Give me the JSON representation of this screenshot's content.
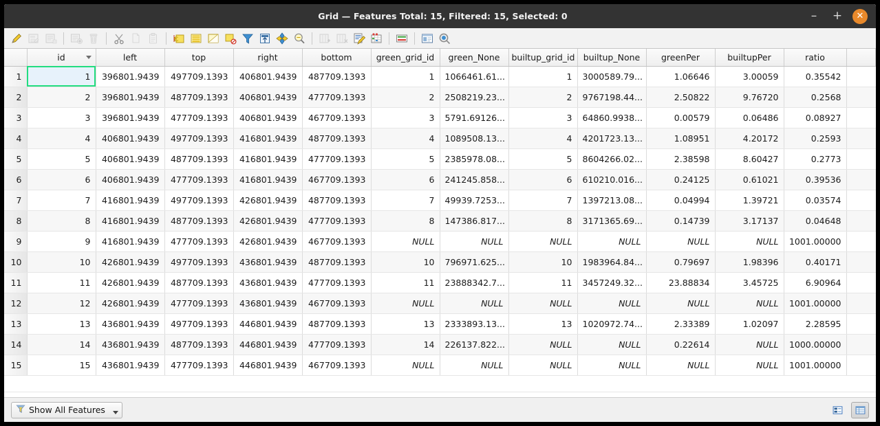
{
  "window": {
    "title": "Grid — Features Total: 15, Filtered: 15, Selected: 0",
    "minimize_label": "–",
    "maximize_label": "+",
    "close_label": "✕"
  },
  "toolbar": {
    "buttons": [
      {
        "name": "toggle-editing-icon",
        "enabled": true
      },
      {
        "name": "save-edits-icon",
        "enabled": false
      },
      {
        "name": "reload-table-icon",
        "enabled": false
      },
      {
        "name": "add-feature-icon",
        "enabled": false
      },
      {
        "name": "delete-selected-icon",
        "enabled": false
      },
      {
        "name": "cut-features-icon",
        "enabled": false
      },
      {
        "name": "copy-features-icon",
        "enabled": false
      },
      {
        "name": "paste-features-icon",
        "enabled": false
      },
      {
        "name": "select-by-expression-icon",
        "enabled": true
      },
      {
        "name": "select-all-icon",
        "enabled": true
      },
      {
        "name": "invert-selection-icon",
        "enabled": true
      },
      {
        "name": "deselect-all-icon",
        "enabled": true
      },
      {
        "name": "filter-selection-icon",
        "enabled": true
      },
      {
        "name": "move-selection-to-top-icon",
        "enabled": true
      },
      {
        "name": "pan-to-selection-icon",
        "enabled": true
      },
      {
        "name": "zoom-to-selection-icon",
        "enabled": true
      },
      {
        "name": "new-field-icon",
        "enabled": false
      },
      {
        "name": "delete-field-icon",
        "enabled": false
      },
      {
        "name": "field-calculator-icon",
        "enabled": true
      },
      {
        "name": "conditional-formatting-icon",
        "enabled": true
      },
      {
        "name": "multi-edit-icon",
        "enabled": true
      },
      {
        "name": "form-view-icon",
        "enabled": true
      },
      {
        "name": "actions-icon",
        "enabled": true
      }
    ]
  },
  "table": {
    "columns": [
      {
        "label": "id",
        "sorted": true
      },
      {
        "label": "left",
        "sorted": false
      },
      {
        "label": "top",
        "sorted": false
      },
      {
        "label": "right",
        "sorted": false
      },
      {
        "label": "bottom",
        "sorted": false
      },
      {
        "label": "green_grid_id",
        "sorted": false
      },
      {
        "label": "green_None",
        "sorted": false
      },
      {
        "label": "builtup_grid_id",
        "sorted": false
      },
      {
        "label": "builtup_None",
        "sorted": false
      },
      {
        "label": "greenPer",
        "sorted": false
      },
      {
        "label": "builtupPer",
        "sorted": false
      },
      {
        "label": "ratio",
        "sorted": false
      }
    ],
    "selected_cell": {
      "row": 0,
      "col": 0
    },
    "rows": [
      {
        "n": "1",
        "cells": [
          "1",
          "396801.9439",
          "497709.1393",
          "406801.9439",
          "487709.1393",
          "1",
          "1066461.61...",
          "1",
          "3000589.79...",
          "1.06646",
          "3.00059",
          "0.35542"
        ]
      },
      {
        "n": "2",
        "cells": [
          "2",
          "396801.9439",
          "487709.1393",
          "406801.9439",
          "477709.1393",
          "2",
          "2508219.23...",
          "2",
          "9767198.44...",
          "2.50822",
          "9.76720",
          "0.2568"
        ]
      },
      {
        "n": "3",
        "cells": [
          "3",
          "396801.9439",
          "477709.1393",
          "406801.9439",
          "467709.1393",
          "3",
          "5791.69126...",
          "3",
          "64860.9938...",
          "0.00579",
          "0.06486",
          "0.08927"
        ]
      },
      {
        "n": "4",
        "cells": [
          "4",
          "406801.9439",
          "497709.1393",
          "416801.9439",
          "487709.1393",
          "4",
          "1089508.13...",
          "4",
          "4201723.13...",
          "1.08951",
          "4.20172",
          "0.2593"
        ]
      },
      {
        "n": "5",
        "cells": [
          "5",
          "406801.9439",
          "487709.1393",
          "416801.9439",
          "477709.1393",
          "5",
          "2385978.08...",
          "5",
          "8604266.02...",
          "2.38598",
          "8.60427",
          "0.2773"
        ]
      },
      {
        "n": "6",
        "cells": [
          "6",
          "406801.9439",
          "477709.1393",
          "416801.9439",
          "467709.1393",
          "6",
          "241245.858...",
          "6",
          "610210.016...",
          "0.24125",
          "0.61021",
          "0.39536"
        ]
      },
      {
        "n": "7",
        "cells": [
          "7",
          "416801.9439",
          "497709.1393",
          "426801.9439",
          "487709.1393",
          "7",
          "49939.7253...",
          "7",
          "1397213.08...",
          "0.04994",
          "1.39721",
          "0.03574"
        ]
      },
      {
        "n": "8",
        "cells": [
          "8",
          "416801.9439",
          "487709.1393",
          "426801.9439",
          "477709.1393",
          "8",
          "147386.817...",
          "8",
          "3171365.69...",
          "0.14739",
          "3.17137",
          "0.04648"
        ]
      },
      {
        "n": "9",
        "cells": [
          "9",
          "416801.9439",
          "477709.1393",
          "426801.9439",
          "467709.1393",
          "NULL",
          "NULL",
          "NULL",
          "NULL",
          "NULL",
          "NULL",
          "1001.00000"
        ]
      },
      {
        "n": "10",
        "cells": [
          "10",
          "426801.9439",
          "497709.1393",
          "436801.9439",
          "487709.1393",
          "10",
          "796971.625...",
          "10",
          "1983964.84...",
          "0.79697",
          "1.98396",
          "0.40171"
        ]
      },
      {
        "n": "11",
        "cells": [
          "11",
          "426801.9439",
          "487709.1393",
          "436801.9439",
          "477709.1393",
          "11",
          "23888342.7...",
          "11",
          "3457249.32...",
          "23.88834",
          "3.45725",
          "6.90964"
        ]
      },
      {
        "n": "12",
        "cells": [
          "12",
          "426801.9439",
          "477709.1393",
          "436801.9439",
          "467709.1393",
          "NULL",
          "NULL",
          "NULL",
          "NULL",
          "NULL",
          "NULL",
          "1001.00000"
        ]
      },
      {
        "n": "13",
        "cells": [
          "13",
          "436801.9439",
          "497709.1393",
          "446801.9439",
          "487709.1393",
          "13",
          "2333893.13...",
          "13",
          "1020972.74...",
          "2.33389",
          "1.02097",
          "2.28595"
        ]
      },
      {
        "n": "14",
        "cells": [
          "14",
          "436801.9439",
          "487709.1393",
          "446801.9439",
          "477709.1393",
          "14",
          "226137.822...",
          "NULL",
          "NULL",
          "0.22614",
          "NULL",
          "1000.00000"
        ]
      },
      {
        "n": "15",
        "cells": [
          "15",
          "436801.9439",
          "477709.1393",
          "446801.9439",
          "467709.1393",
          "NULL",
          "NULL",
          "NULL",
          "NULL",
          "NULL",
          "NULL",
          "1001.00000"
        ]
      }
    ]
  },
  "statusbar": {
    "filter_label": "Show All Features",
    "filter_icon": "funnel-icon",
    "view_form_icon": "form-view-icon",
    "view_table_icon": "table-view-icon"
  },
  "colors": {
    "titlebar": "#333333",
    "close_button": "#e8892b",
    "selection_outline": "#22dd7f",
    "selection_fill": "#e7f2fb",
    "null_text": "#949494"
  }
}
